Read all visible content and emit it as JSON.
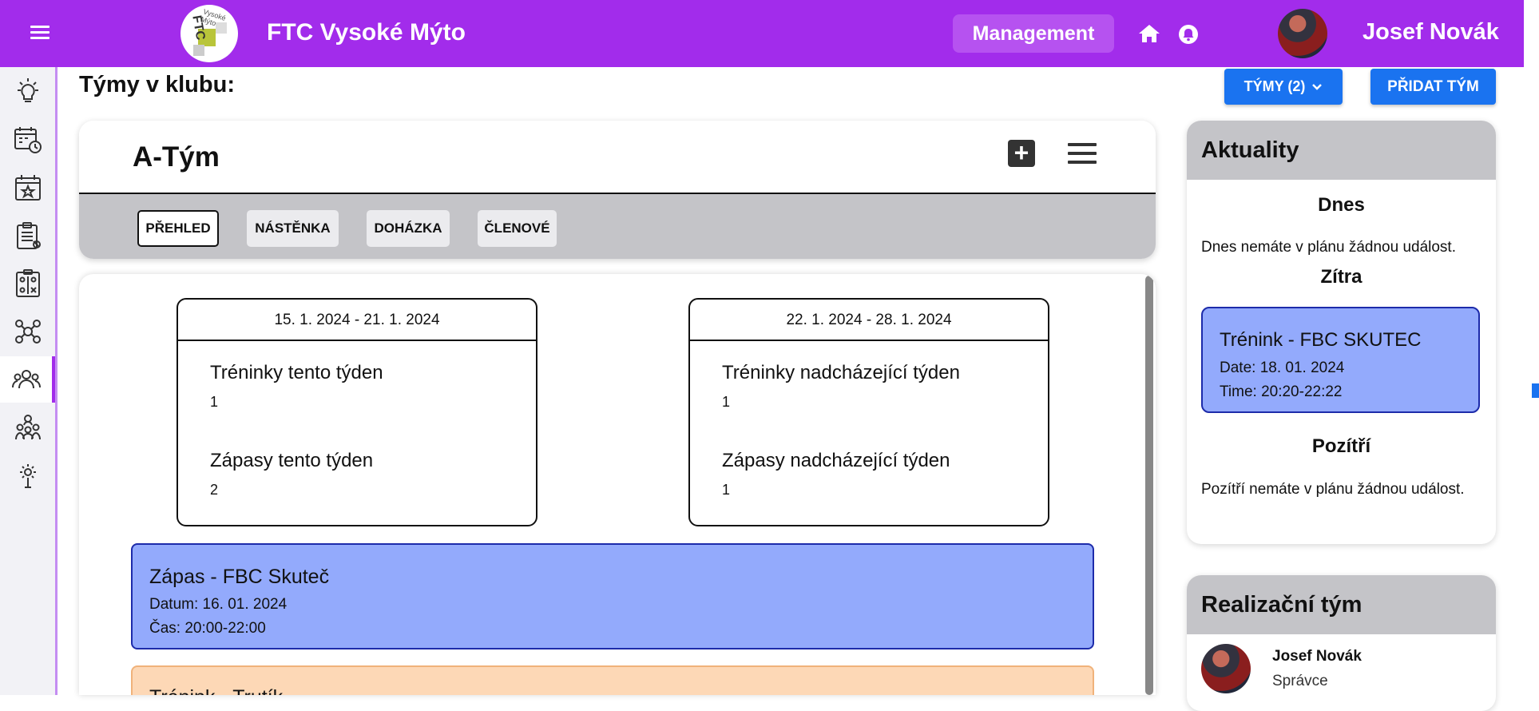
{
  "header": {
    "club_name": "FTC Vysoké Mýto",
    "logo_text": "FTC",
    "logo_subtext": "Vysoké Mýto",
    "management_label": "Management",
    "user_name": "Josef Novák",
    "brand_color": "#a22ceb"
  },
  "sidebar": {
    "items": [
      {
        "icon": "lightbulb-icon"
      },
      {
        "icon": "calendar-clock-icon"
      },
      {
        "icon": "calendar-star-icon"
      },
      {
        "icon": "clipboard-list-icon"
      },
      {
        "icon": "tactics-board-icon"
      },
      {
        "icon": "network-users-icon"
      },
      {
        "icon": "team-users-icon",
        "active": true
      },
      {
        "icon": "group-users-icon"
      },
      {
        "icon": "settings-gear-icon"
      }
    ]
  },
  "page": {
    "title": "Týmy v klubu:",
    "teams_button": "TÝMY (2)",
    "add_team_button": "PŘIDAT TÝM"
  },
  "team": {
    "name": "A-Tým",
    "tabs": [
      {
        "label": "PŘEHLED",
        "active": true
      },
      {
        "label": "NÁSTĚNKA"
      },
      {
        "label": "DOHÁZKA"
      },
      {
        "label": "ČLENOVÉ"
      }
    ]
  },
  "weeks": [
    {
      "range": "15. 1. 2024 - 21. 1. 2024",
      "trainings_label": "Tréninky tento týden",
      "trainings_value": "1",
      "matches_label": "Zápasy tento týden",
      "matches_value": "2"
    },
    {
      "range": "22. 1. 2024 - 28. 1. 2024",
      "trainings_label": "Tréninky nadcházející týden",
      "trainings_value": "1",
      "matches_label": "Zápasy nadcházející týden",
      "matches_value": "1"
    }
  ],
  "events": [
    {
      "title": "Zápas - FBC Skuteč",
      "date_line": "Datum: 16. 01. 2024",
      "time_line": "Čas: 20:00-22:00",
      "color": "#93aafc"
    },
    {
      "title": "Trénink - Trutík",
      "color": "#fdd8b6"
    }
  ],
  "news": {
    "title": "Aktuality",
    "today_title": "Dnes",
    "today_text": "Dnes nemáte v plánu žádnou událost.",
    "tomorrow_title": "Zítra",
    "tomorrow_event": {
      "title": "Trénink - FBC SKUTEC",
      "date_line": "Date: 18. 01. 2024",
      "time_line": "Time: 20:20-22:22"
    },
    "after_title": "Pozítří",
    "after_text": "Pozítří nemáte v plánu žádnou událost."
  },
  "staff": {
    "title": "Realizační tým",
    "members": [
      {
        "name": "Josef Novák",
        "role": "Správce"
      }
    ]
  }
}
